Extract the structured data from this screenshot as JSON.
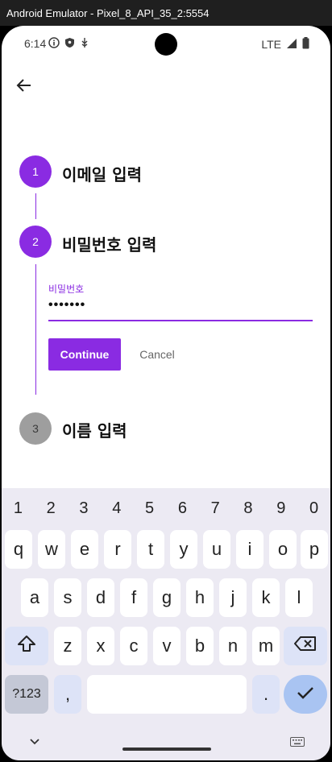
{
  "window": {
    "title": "Android Emulator - Pixel_8_API_35_2:5554"
  },
  "status_bar": {
    "time": "6:14",
    "network": "LTE"
  },
  "stepper": {
    "steps": [
      {
        "number": "1",
        "title": "이메일 입력"
      },
      {
        "number": "2",
        "title": "비밀번호 입력"
      },
      {
        "number": "3",
        "title": "이름 입력"
      }
    ],
    "active_index": 1
  },
  "password_field": {
    "label": "비밀번호",
    "value": "•••••••"
  },
  "actions": {
    "continue_label": "Continue",
    "cancel_label": "Cancel"
  },
  "keyboard": {
    "number_row": [
      "1",
      "2",
      "3",
      "4",
      "5",
      "6",
      "7",
      "8",
      "9",
      "0"
    ],
    "row1": [
      "q",
      "w",
      "e",
      "r",
      "t",
      "y",
      "u",
      "i",
      "o",
      "p"
    ],
    "row2": [
      "a",
      "s",
      "d",
      "f",
      "g",
      "h",
      "j",
      "k",
      "l"
    ],
    "row3": [
      "z",
      "x",
      "c",
      "v",
      "b",
      "n",
      "m"
    ],
    "symbols_label": "?123",
    "comma": ",",
    "period": "."
  },
  "colors": {
    "accent": "#8a2be2",
    "inactive_step": "#9e9e9e",
    "keyboard_bg": "#eceaf3",
    "enter_key": "#a9c4f2"
  },
  "icons": {
    "back": "arrow-left-icon",
    "backspace": "backspace-icon",
    "shift": "shift-icon",
    "enter": "check-icon",
    "hide_keyboard": "chevron-down-icon",
    "keyboard_switch": "keyboard-icon"
  }
}
